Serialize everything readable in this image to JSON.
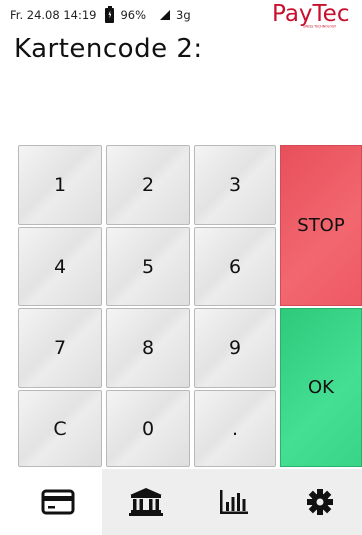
{
  "status": {
    "datetime": "Fr. 24.08 14:19",
    "battery": "96%",
    "network": "3g",
    "battery_icon": "battery-charging-icon",
    "signal_icon": "signal-icon"
  },
  "brand": {
    "name": "PayTec",
    "tagline": "SWISS TECHNOLOGY",
    "color": "#c8102e"
  },
  "title": "Kartencode 2:",
  "keypad": {
    "keys": [
      "1",
      "2",
      "3",
      "4",
      "5",
      "6",
      "7",
      "8",
      "9",
      "C",
      "0",
      "."
    ]
  },
  "actions": {
    "stop_label": "STOP",
    "ok_label": "OK",
    "stop_color": "#ee5a64",
    "ok_color": "#3ad488"
  },
  "tabs": [
    {
      "icon": "card-icon",
      "active": true
    },
    {
      "icon": "bank-icon",
      "active": false
    },
    {
      "icon": "bar-chart-icon",
      "active": false
    },
    {
      "icon": "gear-icon",
      "active": false
    }
  ]
}
